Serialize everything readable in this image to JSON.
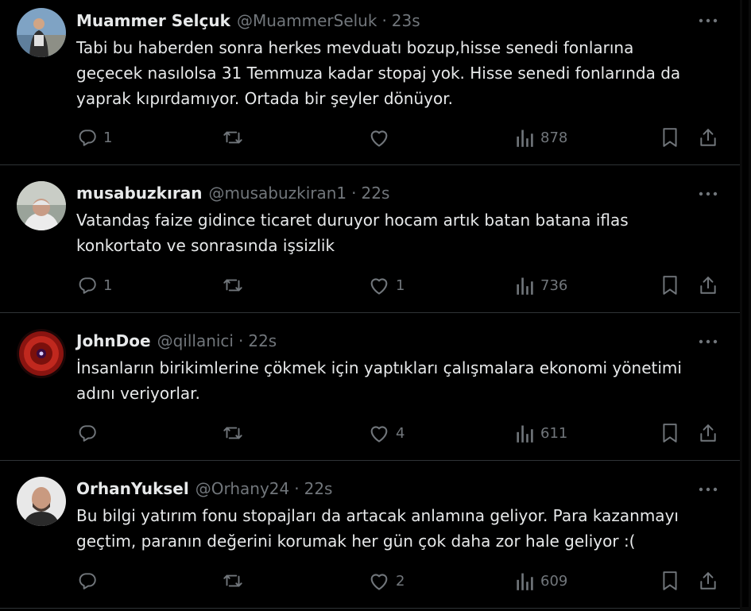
{
  "colors": {
    "background": "#000000",
    "text_primary": "#e7e9ea",
    "text_secondary": "#71767b",
    "divider": "#2f3336"
  },
  "tweets": [
    {
      "name": "Muammer Selçuk",
      "handle": "@MuammerSeluk",
      "separator": "·",
      "time": "23s",
      "text": "Tabi bu haberden sonra herkes mevduatı bozup,hisse senedi fonlarına\ngeçecek nasılolsa 31 Temmuza kadar stopaj yok. Hisse senedi fonlarında da\nyaprak kıpırdamıyor. Ortada bir şeyler dönüyor.",
      "replies": "1",
      "retweets": "",
      "likes": "",
      "views": "878"
    },
    {
      "name": "musabuzkıran",
      "handle": "@musabuzkiran1",
      "separator": "·",
      "time": "22s",
      "text": "Vatandaş faize gidince ticaret duruyor hocam artık batan batana iflas\nkonkortato ve sonrasında işsizlik",
      "replies": "1",
      "retweets": "",
      "likes": "1",
      "views": "736"
    },
    {
      "name": "JohnDoe",
      "handle": "@qillanici",
      "separator": "·",
      "time": "22s",
      "text": "İnsanların birikimlerine çökmek için yaptıkları çalışmalara ekonomi yönetimi\nadını veriyorlar.",
      "replies": "",
      "retweets": "",
      "likes": "4",
      "views": "611"
    },
    {
      "name": "OrhanYuksel",
      "handle": "@Orhany24",
      "separator": "·",
      "time": "22s",
      "text": "Bu bilgi yatırım fonu stopajları da artacak anlamına geliyor. Para kazanmayı\ngeçtim, paranın değerini korumak her gün çok daha zor hale geliyor :(",
      "replies": "",
      "retweets": "",
      "likes": "2",
      "views": "609"
    }
  ],
  "icons": {
    "more": "more-horizontal-icon",
    "reply": "reply-icon",
    "retweet": "retweet-icon",
    "like": "heart-icon",
    "views": "views-bar-chart-icon",
    "bookmark": "bookmark-icon",
    "share": "share-icon"
  }
}
